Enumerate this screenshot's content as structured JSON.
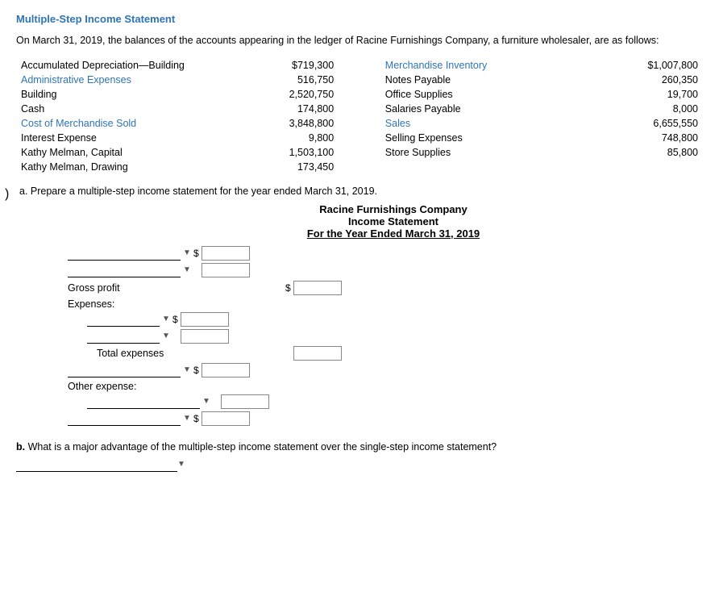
{
  "page": {
    "title": "Multiple-Step Income Statement",
    "intro": "On March 31, 2019, the balances of the accounts appearing in the ledger of Racine Furnishings Company, a furniture wholesaler, are as follows:"
  },
  "accounts_left": [
    {
      "label": "Accumulated Depreciation—Building",
      "value": "$719,300",
      "colored": false
    },
    {
      "label": "Administrative Expenses",
      "value": "516,750",
      "colored": true
    },
    {
      "label": "Building",
      "value": "2,520,750",
      "colored": false
    },
    {
      "label": "Cash",
      "value": "174,800",
      "colored": false
    },
    {
      "label": "Cost of Merchandise Sold",
      "value": "3,848,800",
      "colored": true
    },
    {
      "label": "Interest Expense",
      "value": "9,800",
      "colored": false
    },
    {
      "label": "Kathy Melman, Capital",
      "value": "1,503,100",
      "colored": false
    },
    {
      "label": "Kathy Melman, Drawing",
      "value": "173,450",
      "colored": false
    }
  ],
  "accounts_right": [
    {
      "label": "Merchandise Inventory",
      "value": "$1,007,800",
      "colored": true
    },
    {
      "label": "Notes Payable",
      "value": "260,350",
      "colored": false
    },
    {
      "label": "Office Supplies",
      "value": "19,700",
      "colored": false
    },
    {
      "label": "Salaries Payable",
      "value": "8,000",
      "colored": false
    },
    {
      "label": "Sales",
      "value": "6,655,550",
      "colored": true
    },
    {
      "label": "Selling Expenses",
      "value": "748,800",
      "colored": false
    },
    {
      "label": "Store Supplies",
      "value": "85,800",
      "colored": false
    }
  ],
  "part_a": {
    "instruction": "a. Prepare a multiple-step income statement for the year ended March 31, 2019.",
    "company": {
      "name": "Racine Furnishings Company",
      "statement": "Income Statement",
      "period": "For the Year Ended March 31, 2019"
    },
    "labels": {
      "gross_profit": "Gross profit",
      "expenses": "Expenses:",
      "total_expenses": "Total expenses",
      "other_expense": "Other expense:"
    },
    "dollar_sign": "$"
  },
  "part_b": {
    "label": "b.",
    "question": "What is a major advantage of the multiple-step income statement over the single-step income statement?"
  }
}
